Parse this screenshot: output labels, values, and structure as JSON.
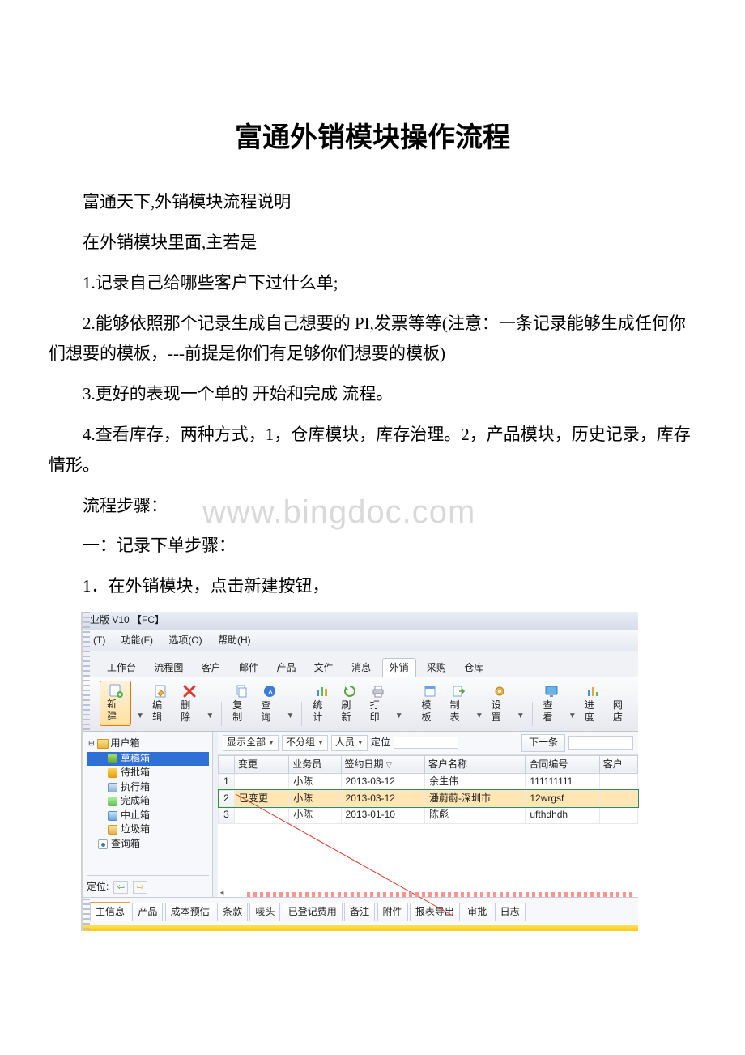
{
  "doc": {
    "title": "富通外销模块操作流程",
    "paras": [
      "富通天下,外销模块流程说明",
      "在外销模块里面,主若是",
      "1.记录自己给哪些客户下过什么单;",
      "2.能够依照那个记录生成自己想要的 PI,发票等等(注意：一条记录能够生成任何你们想要的模板，---前提是你们有足够你们想要的模板)",
      "3.更好的表现一个单的 开始和完成 流程。",
      "4.查看库存，两种方式，1，仓库模块，库存治理。2，产品模块，历史记录，库存情形。",
      "流程步骤：",
      "一：记录下单步骤：",
      "1．在外销模块，点击新建按钮，"
    ],
    "watermark": "www.bingdoc.com"
  },
  "app": {
    "title": "业版 V10 【FC】",
    "menu": {
      "item1": "(T)",
      "item2": "功能(F)",
      "item3": "选项(O)",
      "item4": "帮助(H)"
    },
    "tabs": [
      "工作台",
      "流程图",
      "客户",
      "邮件",
      "产品",
      "文件",
      "消息",
      "外销",
      "采购",
      "仓库"
    ],
    "activeTab": "外销",
    "tool": {
      "new": "新建",
      "edit": "编辑",
      "del": "删除",
      "copy": "复制",
      "query": "查询",
      "stat": "统计",
      "refresh": "刷新",
      "print": "打印",
      "tpl": "模板",
      "rpt": "制表",
      "set": "设置",
      "view": "查看",
      "prog": "进度",
      "net": "网店"
    },
    "tree": {
      "root": "用户箱",
      "draft": "草稿箱",
      "pending": "待批箱",
      "exec": "执行箱",
      "done": "完成箱",
      "stop": "中止箱",
      "trash": "垃圾箱",
      "qbox": "查询箱"
    },
    "filter": {
      "showAll": "显示全部",
      "noGroup": "不分组",
      "person": "人员",
      "locate": "定位",
      "next": "下一条"
    },
    "columns": {
      "c2": "变更",
      "c3": "业务员",
      "c4": "签约日期",
      "c5": "客户名称",
      "c6": "合同编号",
      "c7": "客户"
    },
    "rows": [
      {
        "n": "1",
        "chg": "",
        "staff": "小陈",
        "date": "2013-03-12",
        "cust": "余生伟",
        "no": "111111111"
      },
      {
        "n": "2",
        "chg": "已变更",
        "staff": "小陈",
        "date": "2013-03-12",
        "cust": "潘蔚蔚-深圳市",
        "no": "12wrgsf"
      },
      {
        "n": "3",
        "chg": "",
        "staff": "小陈",
        "date": "2013-01-10",
        "cust": "陈彪",
        "no": "ufthdhdh"
      }
    ],
    "detailTabs": [
      "主信息",
      "产品",
      "成本预估",
      "条款",
      "唛头",
      "已登记费用",
      "备注",
      "附件",
      "报表导出",
      "审批",
      "日志"
    ],
    "locate": "定位:"
  }
}
